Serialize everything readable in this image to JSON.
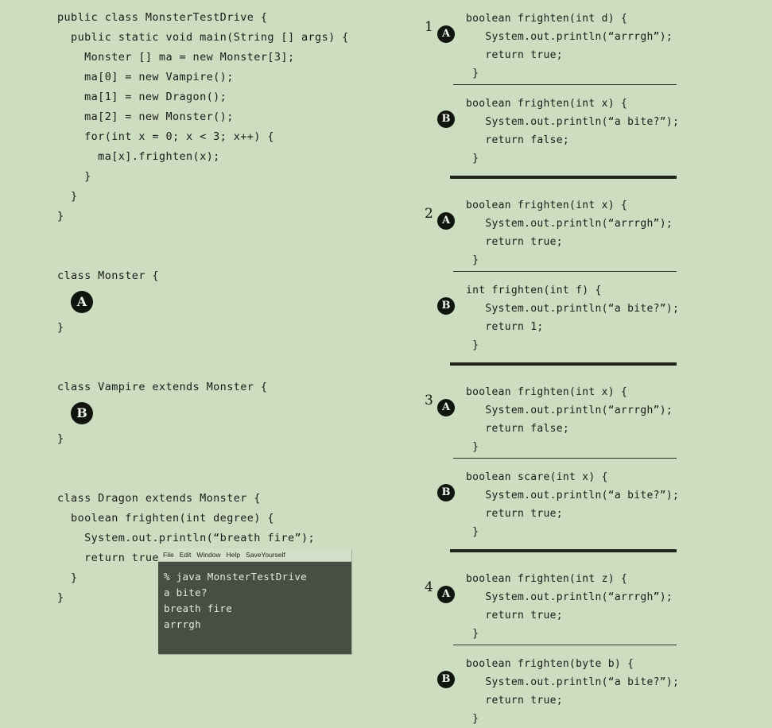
{
  "background_color": "#cdddc0",
  "left_program": {
    "lines": [
      "public class MonsterTestDrive {",
      "  public static void main(String [] args) {",
      "    Monster [] ma = new Monster[3];",
      "    ma[0] = new Vampire();",
      "    ma[1] = new Dragon();",
      "    ma[2] = new Monster();",
      "    for(int x = 0; x < 3; x++) {",
      "      ma[x].frighten(x);",
      "    }",
      "  }",
      "}"
    ],
    "monster_class": {
      "header": "class Monster {",
      "badge": "A",
      "close": "}"
    },
    "vampire_class": {
      "header": "class Vampire extends Monster {",
      "badge": "B",
      "close": "}"
    },
    "dragon_class": {
      "lines": [
        "class Dragon extends Monster {",
        "  boolean frighten(int degree) {",
        "    System.out.println(“breath fire”);",
        "    return true;",
        "  }",
        "}"
      ]
    }
  },
  "terminal": {
    "menu": [
      "File",
      "Edit",
      "Window",
      "Help",
      "SaveYourself"
    ],
    "output": [
      "% java MonsterTestDrive",
      "a bite?",
      "breath fire",
      "arrrgh"
    ],
    "bg_color": "#474f43",
    "text_color": "#e6ead9",
    "menubar_color": "#d3dfc8"
  },
  "options": [
    {
      "number": "1",
      "variants": [
        {
          "label": "A",
          "lines": [
            "boolean frighten(int d) {",
            "   System.out.println(“arrrgh”);",
            "   return true;",
            " }"
          ]
        },
        {
          "label": "B",
          "lines": [
            "boolean frighten(int x) {",
            "   System.out.println(“a bite?”);",
            "   return false;",
            " }"
          ]
        }
      ]
    },
    {
      "number": "2",
      "variants": [
        {
          "label": "A",
          "lines": [
            "boolean frighten(int x) {",
            "   System.out.println(“arrrgh”);",
            "   return true;",
            " }"
          ]
        },
        {
          "label": "B",
          "lines": [
            "int frighten(int f) {",
            "   System.out.println(“a bite?”);",
            "   return 1;",
            " }"
          ]
        }
      ]
    },
    {
      "number": "3",
      "variants": [
        {
          "label": "A",
          "lines": [
            "boolean frighten(int x) {",
            "   System.out.println(“arrrgh”);",
            "   return false;",
            " }"
          ]
        },
        {
          "label": "B",
          "lines": [
            "boolean scare(int x) {",
            "   System.out.println(“a bite?”);",
            "   return true;",
            " }"
          ]
        }
      ]
    },
    {
      "number": "4",
      "variants": [
        {
          "label": "A",
          "lines": [
            "boolean frighten(int z) {",
            "   System.out.println(“arrrgh”);",
            "   return true;",
            " }"
          ]
        },
        {
          "label": "B",
          "lines": [
            "boolean frighten(byte b) {",
            "   System.out.println(“a bite?”);",
            "   return true;",
            " }"
          ]
        }
      ]
    }
  ]
}
